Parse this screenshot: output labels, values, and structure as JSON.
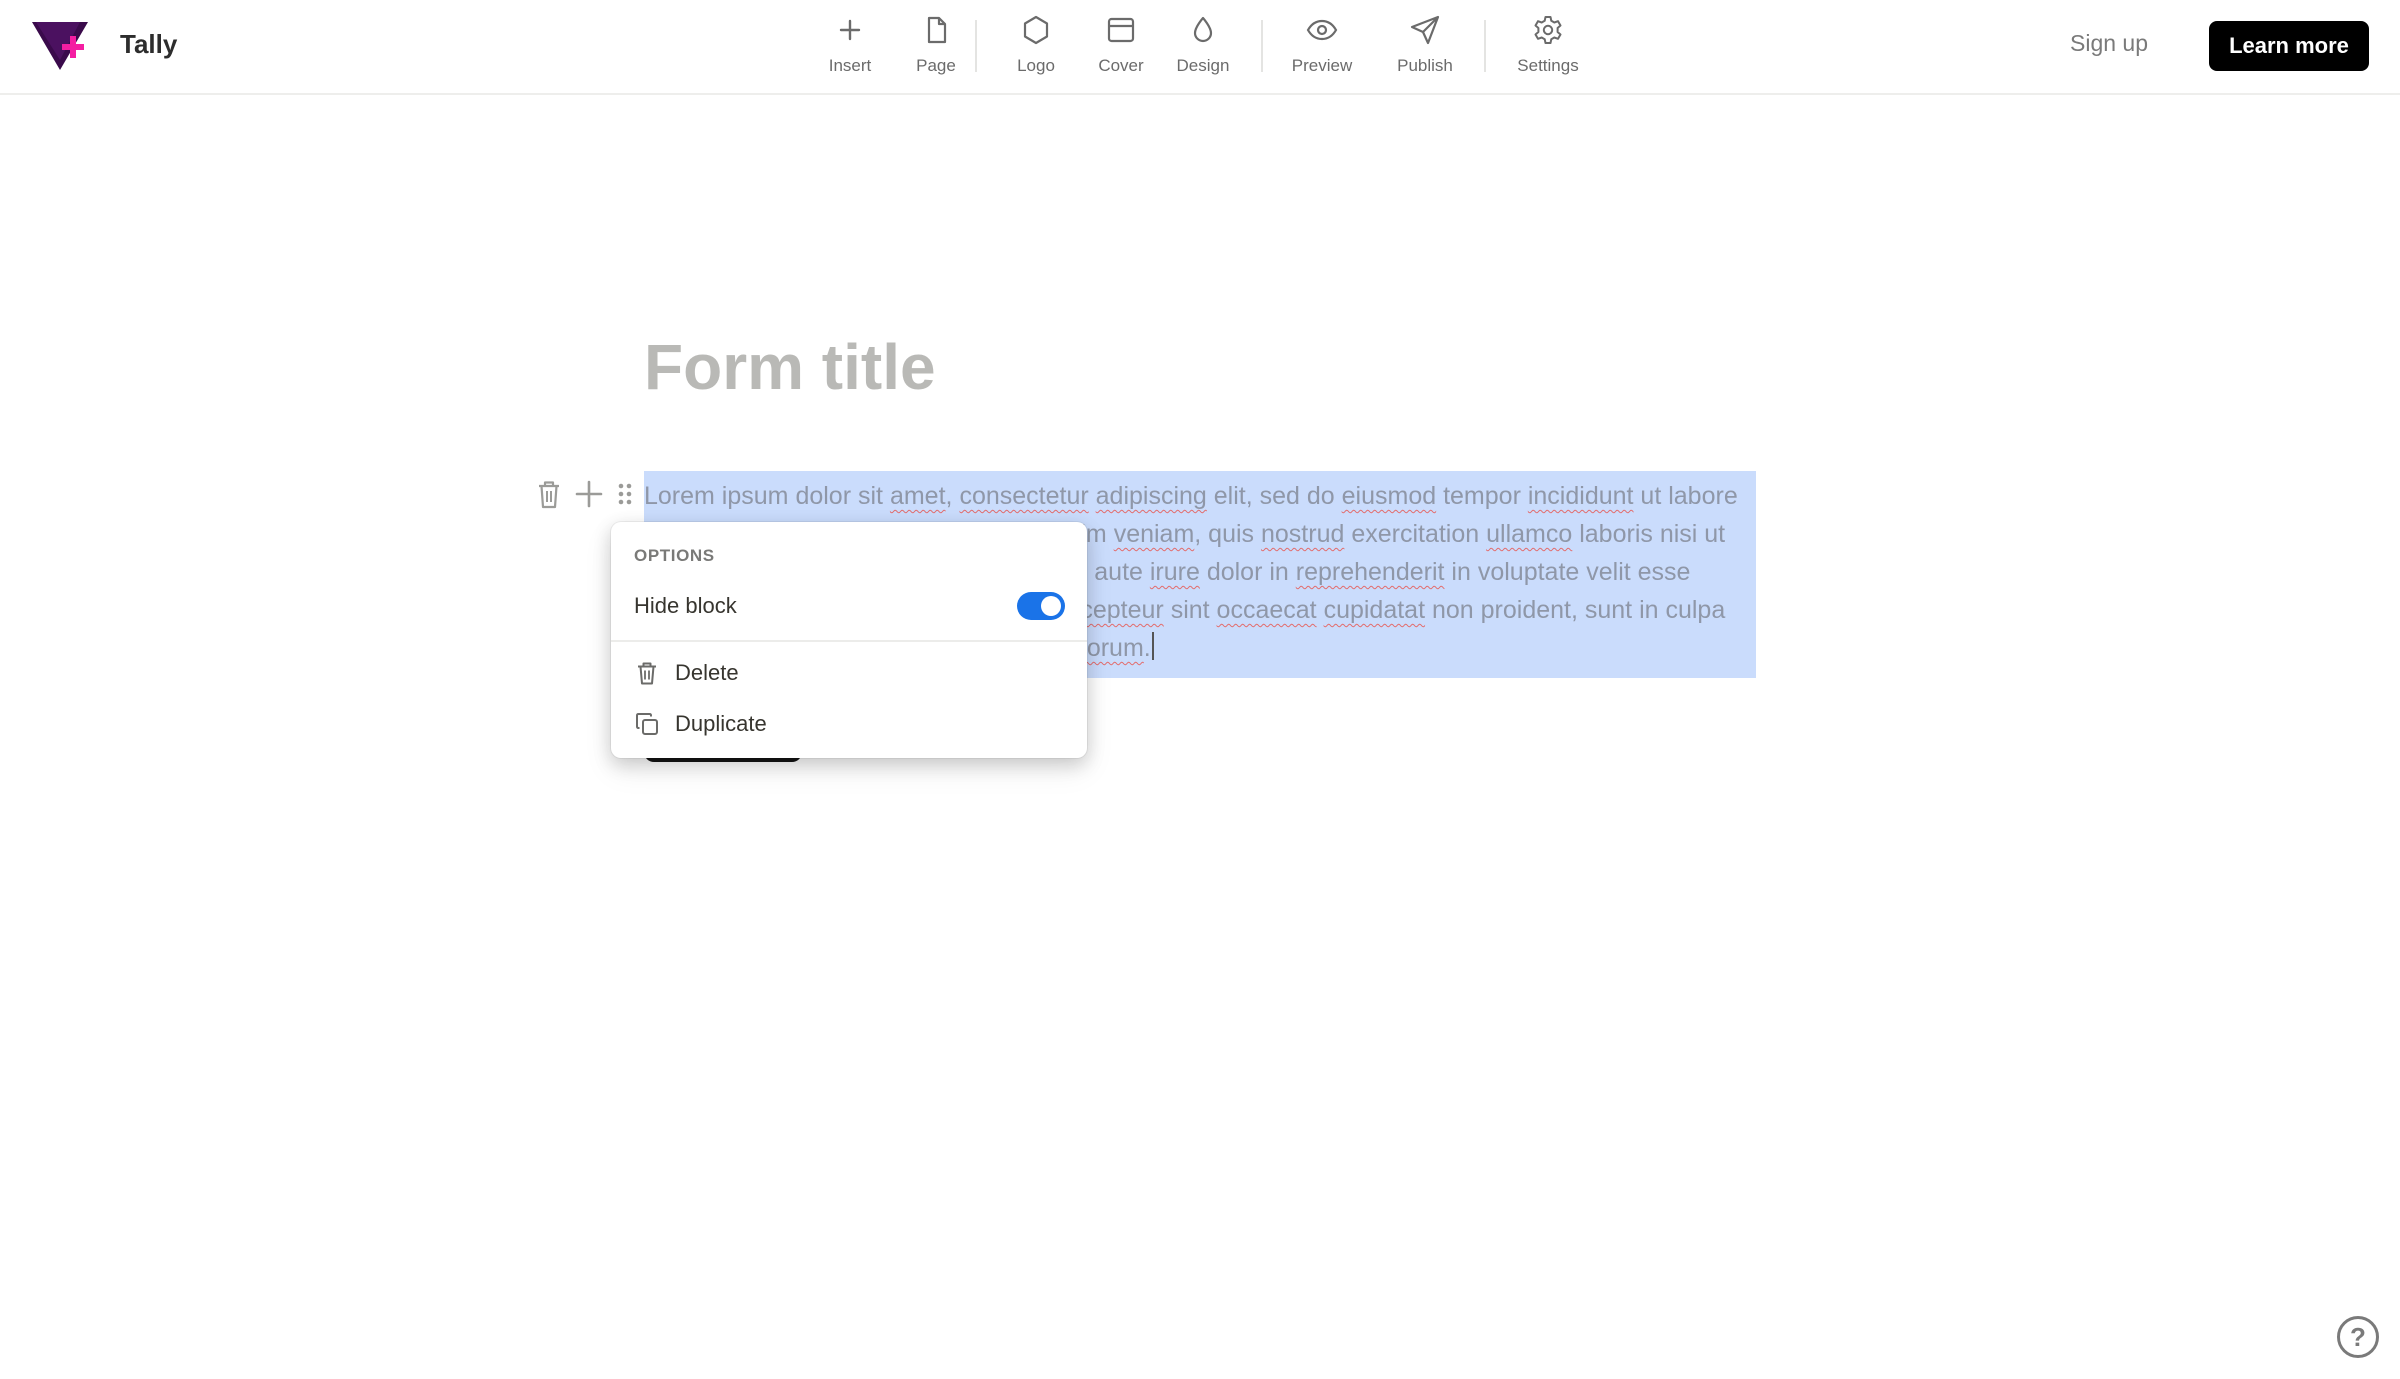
{
  "app": {
    "name": "Tally"
  },
  "toolbar": {
    "insert": "Insert",
    "page": "Page",
    "logo": "Logo",
    "cover": "Cover",
    "design": "Design",
    "preview": "Preview",
    "publish": "Publish",
    "settings": "Settings"
  },
  "header": {
    "signup": "Sign up",
    "learn_more": "Learn more"
  },
  "form": {
    "title_placeholder": "Form title",
    "paragraph": {
      "w1": "Lorem ipsum dolor sit ",
      "w2": "amet",
      "w3": ", ",
      "w4": "consectetur",
      "w5": " ",
      "w6": "adipiscing",
      "w7": " elit, sed do ",
      "w8": "eiusmod",
      "w9": " tempor ",
      "w10": "incididunt",
      "w11": " ut labore et dolore magna aliqua. Ut enim ad minim ",
      "w12": "veniam",
      "w13": ", quis ",
      "w14": "nostrud",
      "w15": " exercitation ",
      "w16": "ullamco",
      "w17": " laboris nisi ut aliquip ex ea commodo consequat. Duis aute ",
      "w18": "irure",
      "w19": " dolor in ",
      "w20": "reprehenderit",
      "w21": " in voluptate velit esse cillum dolore eu fugiat nulla pariatur. ",
      "w22": "Excepteur",
      "w23": " sint ",
      "w24": "occaecat",
      "w25": " ",
      "w26": "cupidatat",
      "w27": " non proident, sunt in culpa qui officia deserunt mollit anim id est ",
      "w28": "laborum",
      "w29": "."
    }
  },
  "options_menu": {
    "header": "OPTIONS",
    "hide_block": "Hide block",
    "hide_block_enabled": true,
    "delete": "Delete",
    "duplicate": "Duplicate"
  },
  "help": {
    "label": "?"
  },
  "colors": {
    "accent_toggle": "#1a73e8",
    "selection": "#cadcfc",
    "logo_dark": "#3b0a4a",
    "logo_pink": "#f41ea2"
  }
}
